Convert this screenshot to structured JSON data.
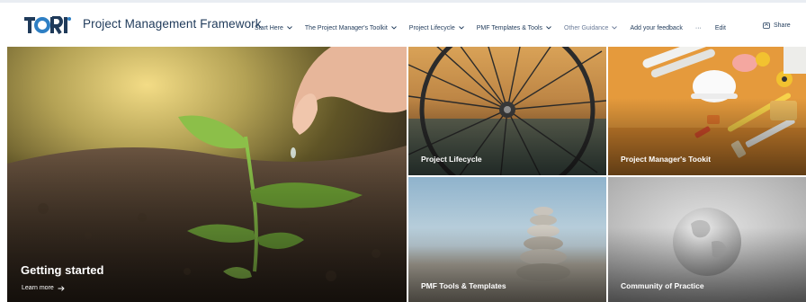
{
  "header": {
    "logo_text": "TORI",
    "site_title": "Project Management Framework",
    "nav": [
      {
        "label": "Start Here",
        "has_chevron": true
      },
      {
        "label": "The Project Manager's Toolkit",
        "has_chevron": true
      },
      {
        "label": "Project Lifecycle",
        "has_chevron": true
      },
      {
        "label": "PMF Templates & Tools",
        "has_chevron": true
      },
      {
        "label": "Other Guidance",
        "has_chevron": true
      },
      {
        "label": "Add your feedback",
        "has_chevron": false
      },
      {
        "label": "···",
        "has_chevron": false
      },
      {
        "label": "Edit",
        "has_chevron": false
      }
    ],
    "share_label": "Share",
    "icons": {
      "chevron": "chevron-down-icon",
      "share": "share-icon"
    }
  },
  "hero": {
    "main": {
      "title": "Getting started",
      "link": "Learn more",
      "link_icon": "arrow-right-icon"
    },
    "tiles": [
      {
        "title": "Project Lifecycle"
      },
      {
        "title": "Project Manager's Tookit"
      },
      {
        "title": "PMF Tools & Templates"
      },
      {
        "title": "Community of Practice"
      }
    ]
  },
  "colors": {
    "brand_navy": "#1f3a5a",
    "brand_blue": "#2e7fc4",
    "nav_muted": "#6b7c99"
  }
}
